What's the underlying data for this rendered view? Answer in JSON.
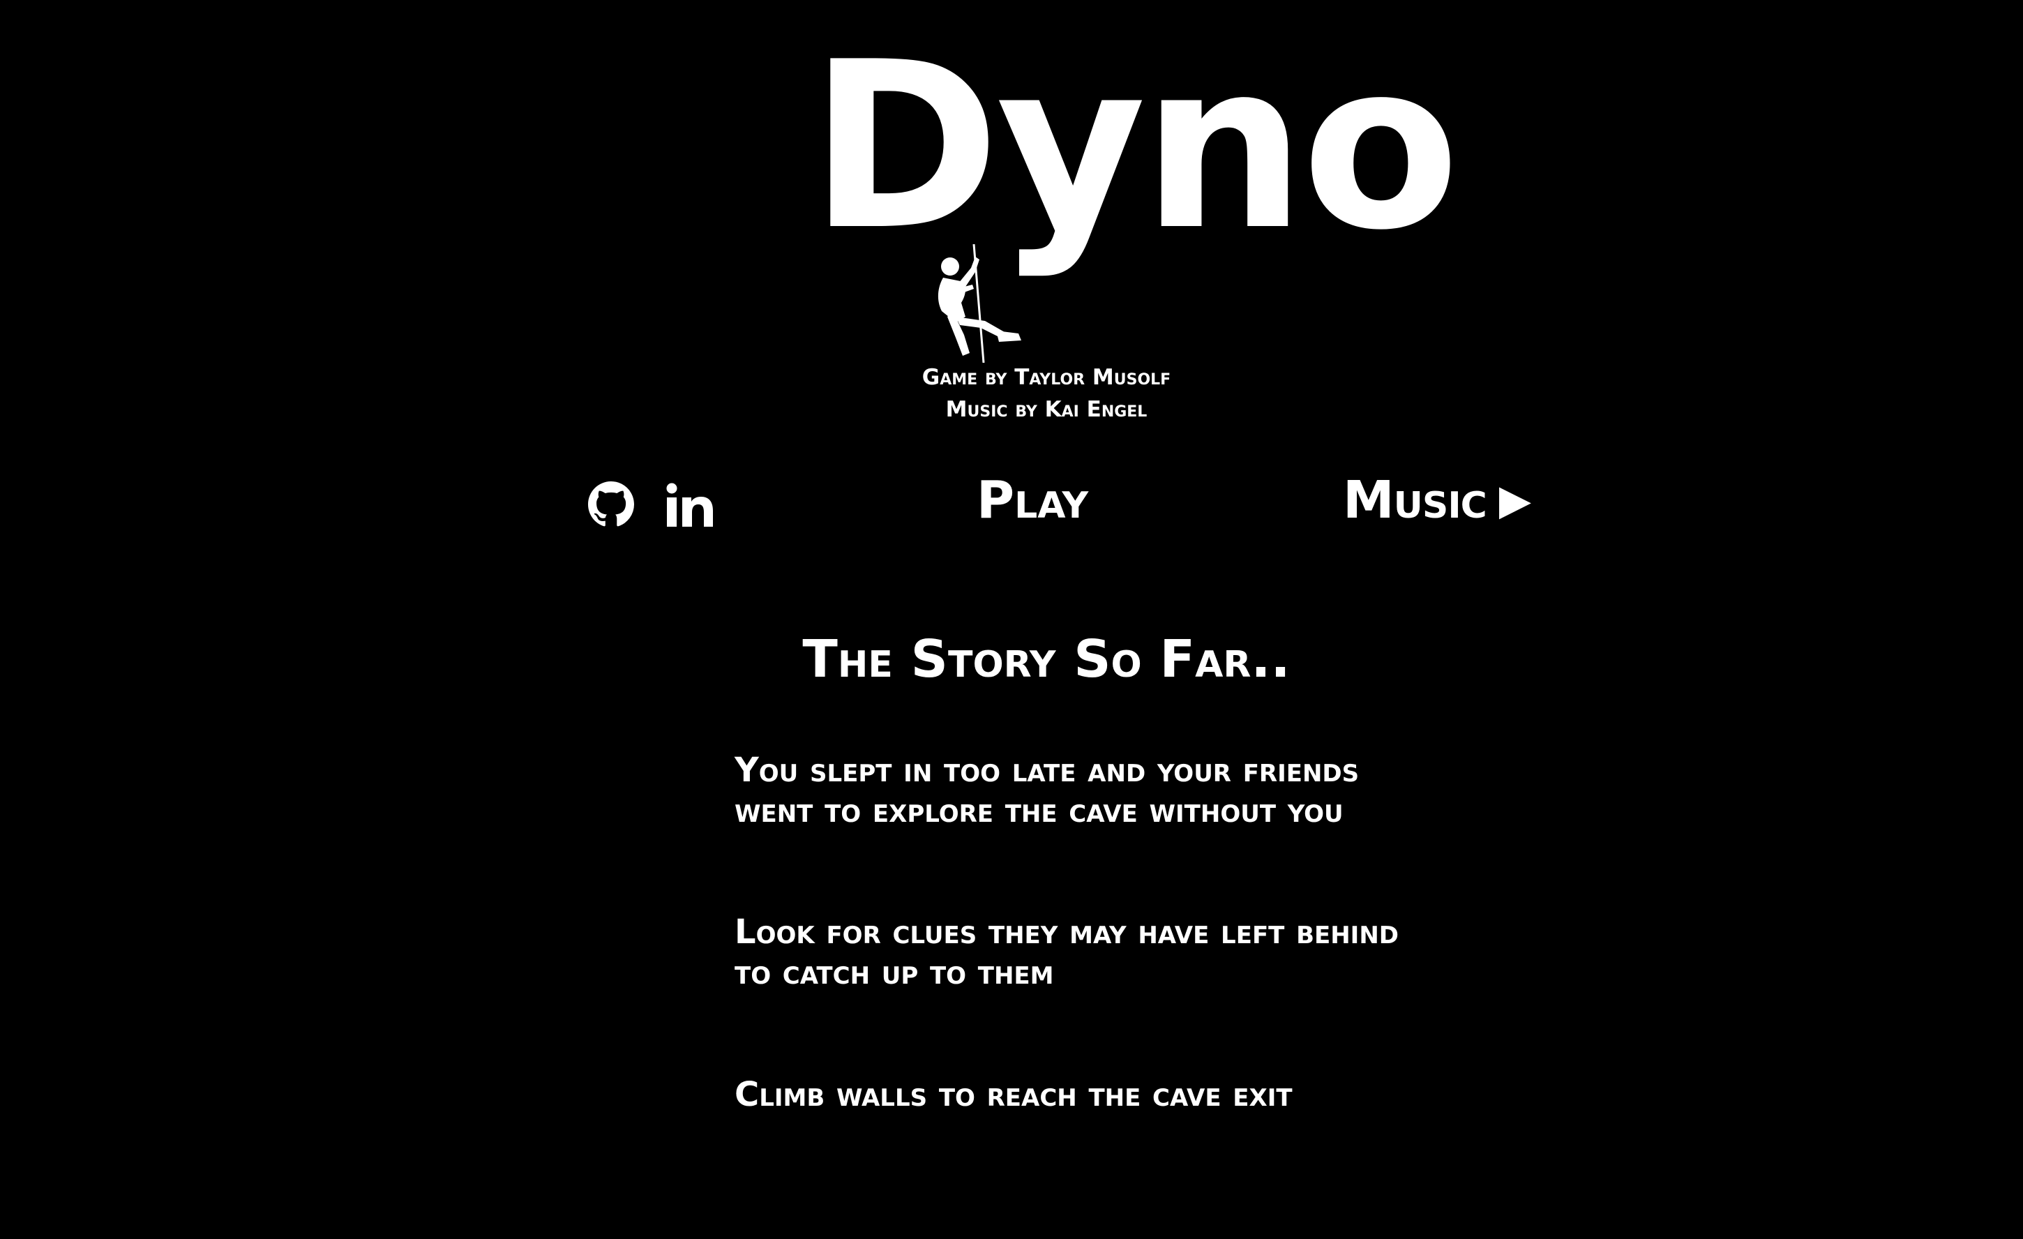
{
  "title": "Dyno",
  "credits": {
    "game": "Game by Taylor Musolf",
    "music": "Music by Kai Engel"
  },
  "nav": {
    "github_icon": "github-icon",
    "linkedin_icon": "linkedin-icon",
    "play_label": "Play",
    "music_label": "Music",
    "music_icon": "▶"
  },
  "story": {
    "heading": "The Story So Far..",
    "paragraphs": [
      {
        "line1": "You slept in too late and your friends",
        "line2": "went to explore the cave without you"
      },
      {
        "line1": "Look for clues they may have left behind",
        "line2": "to catch up to them"
      },
      {
        "line1": "Climb walls to reach the cave exit"
      }
    ]
  },
  "colors": {
    "background": "#000000",
    "foreground": "#ffffff"
  }
}
